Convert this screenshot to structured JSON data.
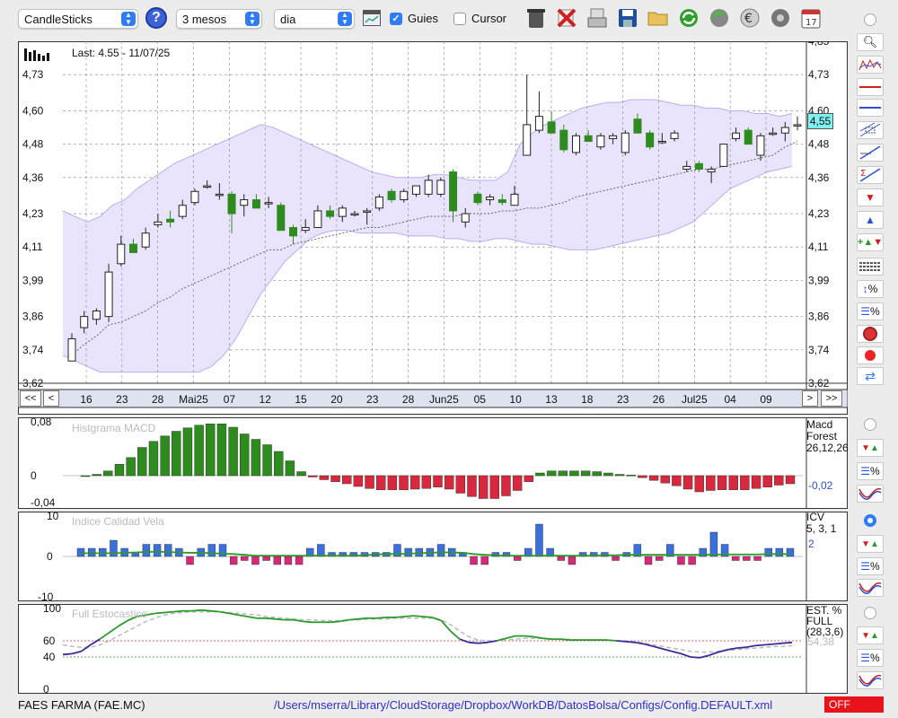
{
  "toolbar": {
    "chart_type": "CandleSticks",
    "period": "3 mesos",
    "interval": "dia",
    "guides_label": "Guies",
    "guides_checked": true,
    "cursor_label": "Cursor",
    "cursor_checked": false
  },
  "main_chart": {
    "last_label": "Last: 4.55 - 11/07/25",
    "current_price_label": "4,55",
    "y_ticks": [
      "4,73",
      "4,60",
      "4,48",
      "4,36",
      "4,23",
      "4,11",
      "3,99",
      "3,86",
      "3,74",
      "3,62"
    ],
    "y_top_partial": "4,85",
    "x_labels": [
      "16",
      "23",
      "28",
      "Mai25",
      "07",
      "12",
      "15",
      "20",
      "23",
      "28",
      "Jun25",
      "05",
      "10",
      "13",
      "18",
      "23",
      "26",
      "Jul25",
      "04",
      "09"
    ],
    "nav": {
      "first": "<<",
      "prev": "<",
      "next": ">",
      "last": ">>"
    }
  },
  "macd": {
    "title": "Histgrama MACD",
    "y_ticks": [
      "0,08",
      "0",
      "-0,04"
    ],
    "legend_name": "Macd",
    "legend_sub": "Forest",
    "legend_params": "26,12,26",
    "value": "-0,02"
  },
  "icv": {
    "title": "Indice Calidad Vela",
    "y_ticks": [
      "10",
      "0",
      "-10"
    ],
    "legend_name": "ICV",
    "legend_params": "5, 3, 1",
    "value": "2"
  },
  "stoch": {
    "title": "Full Estocastico",
    "y_ticks": [
      "100",
      "60",
      "40",
      "0"
    ],
    "legend_name": "EST. %",
    "legend_sub": "FULL",
    "legend_params": "(28,3,6)",
    "value": "54,38"
  },
  "status": {
    "ticker": "FAES FARMA (FAE.MC)",
    "path": "/Users/mserra/Library/CloudStorage/Dropbox/WorkDB/DatosBolsa/Configs/Config.DEFAULT.xml",
    "off_label": "OFF"
  },
  "colors": {
    "up": "#2e8b1e",
    "down": "#d8283e",
    "band": "#e9e4fb",
    "bandline": "#b9aef0",
    "accent": "#2f7cf6"
  },
  "chart_data": {
    "type": "candlestick",
    "ylim": [
      3.62,
      4.85
    ],
    "candles": [
      {
        "o": 3.7,
        "h": 3.8,
        "l": 3.7,
        "c": 3.78
      },
      {
        "o": 3.82,
        "h": 3.88,
        "l": 3.8,
        "c": 3.86
      },
      {
        "o": 3.85,
        "h": 3.89,
        "l": 3.83,
        "c": 3.88
      },
      {
        "o": 3.86,
        "h": 4.05,
        "l": 3.84,
        "c": 4.02
      },
      {
        "o": 4.05,
        "h": 4.15,
        "l": 4.04,
        "c": 4.12
      },
      {
        "o": 4.12,
        "h": 4.14,
        "l": 4.09,
        "c": 4.09
      },
      {
        "o": 4.11,
        "h": 4.18,
        "l": 4.1,
        "c": 4.16
      },
      {
        "o": 4.19,
        "h": 4.23,
        "l": 4.18,
        "c": 4.2
      },
      {
        "o": 4.21,
        "h": 4.24,
        "l": 4.18,
        "c": 4.2
      },
      {
        "o": 4.22,
        "h": 4.28,
        "l": 4.21,
        "c": 4.26
      },
      {
        "o": 4.27,
        "h": 4.32,
        "l": 4.26,
        "c": 4.31
      },
      {
        "o": 4.33,
        "h": 4.35,
        "l": 4.32,
        "c": 4.33
      },
      {
        "o": 4.3,
        "h": 4.34,
        "l": 4.28,
        "c": 4.3
      },
      {
        "o": 4.3,
        "h": 4.31,
        "l": 4.16,
        "c": 4.23
      },
      {
        "o": 4.26,
        "h": 4.3,
        "l": 4.22,
        "c": 4.28
      },
      {
        "o": 4.28,
        "h": 4.3,
        "l": 4.25,
        "c": 4.25
      },
      {
        "o": 4.27,
        "h": 4.29,
        "l": 4.25,
        "c": 4.27
      },
      {
        "o": 4.26,
        "h": 4.27,
        "l": 4.17,
        "c": 4.17
      },
      {
        "o": 4.18,
        "h": 4.19,
        "l": 4.12,
        "c": 4.15
      },
      {
        "o": 4.17,
        "h": 4.21,
        "l": 4.16,
        "c": 4.18
      },
      {
        "o": 4.18,
        "h": 4.26,
        "l": 4.18,
        "c": 4.24
      },
      {
        "o": 4.24,
        "h": 4.26,
        "l": 4.21,
        "c": 4.22
      },
      {
        "o": 4.22,
        "h": 4.26,
        "l": 4.2,
        "c": 4.25
      },
      {
        "o": 4.23,
        "h": 4.24,
        "l": 4.22,
        "c": 4.23
      },
      {
        "o": 4.24,
        "h": 4.25,
        "l": 4.19,
        "c": 4.24
      },
      {
        "o": 4.25,
        "h": 4.3,
        "l": 4.24,
        "c": 4.29
      },
      {
        "o": 4.31,
        "h": 4.32,
        "l": 4.27,
        "c": 4.28
      },
      {
        "o": 4.28,
        "h": 4.32,
        "l": 4.27,
        "c": 4.31
      },
      {
        "o": 4.3,
        "h": 4.33,
        "l": 4.29,
        "c": 4.33
      },
      {
        "o": 4.3,
        "h": 4.37,
        "l": 4.29,
        "c": 4.35
      },
      {
        "o": 4.3,
        "h": 4.36,
        "l": 4.29,
        "c": 4.35
      },
      {
        "o": 4.38,
        "h": 4.39,
        "l": 4.2,
        "c": 4.24
      },
      {
        "o": 4.2,
        "h": 4.25,
        "l": 4.18,
        "c": 4.23
      },
      {
        "o": 4.3,
        "h": 4.31,
        "l": 4.26,
        "c": 4.27
      },
      {
        "o": 4.28,
        "h": 4.3,
        "l": 4.26,
        "c": 4.29
      },
      {
        "o": 4.28,
        "h": 4.3,
        "l": 4.26,
        "c": 4.27
      },
      {
        "o": 4.26,
        "h": 4.33,
        "l": 4.26,
        "c": 4.3
      },
      {
        "o": 4.44,
        "h": 4.73,
        "l": 4.44,
        "c": 4.55
      },
      {
        "o": 4.53,
        "h": 4.67,
        "l": 4.52,
        "c": 4.58
      },
      {
        "o": 4.56,
        "h": 4.6,
        "l": 4.52,
        "c": 4.52
      },
      {
        "o": 4.53,
        "h": 4.55,
        "l": 4.45,
        "c": 4.46
      },
      {
        "o": 4.45,
        "h": 4.52,
        "l": 4.44,
        "c": 4.51
      },
      {
        "o": 4.51,
        "h": 4.53,
        "l": 4.49,
        "c": 4.49
      },
      {
        "o": 4.47,
        "h": 4.52,
        "l": 4.46,
        "c": 4.51
      },
      {
        "o": 4.5,
        "h": 4.52,
        "l": 4.48,
        "c": 4.51
      },
      {
        "o": 4.45,
        "h": 4.53,
        "l": 4.44,
        "c": 4.52
      },
      {
        "o": 4.57,
        "h": 4.59,
        "l": 4.52,
        "c": 4.52
      },
      {
        "o": 4.52,
        "h": 4.53,
        "l": 4.46,
        "c": 4.47
      },
      {
        "o": 4.49,
        "h": 4.52,
        "l": 4.48,
        "c": 4.49
      },
      {
        "o": 4.5,
        "h": 4.53,
        "l": 4.49,
        "c": 4.52
      },
      {
        "o": 4.39,
        "h": 4.42,
        "l": 4.38,
        "c": 4.4
      },
      {
        "o": 4.41,
        "h": 4.42,
        "l": 4.38,
        "c": 4.39
      },
      {
        "o": 4.38,
        "h": 4.4,
        "l": 4.34,
        "c": 4.39
      },
      {
        "o": 4.4,
        "h": 4.48,
        "l": 4.4,
        "c": 4.48
      },
      {
        "o": 4.5,
        "h": 4.54,
        "l": 4.49,
        "c": 4.52
      },
      {
        "o": 4.53,
        "h": 4.54,
        "l": 4.48,
        "c": 4.48
      },
      {
        "o": 4.44,
        "h": 4.52,
        "l": 4.42,
        "c": 4.51
      },
      {
        "o": 4.52,
        "h": 4.54,
        "l": 4.51,
        "c": 4.52
      },
      {
        "o": 4.52,
        "h": 4.56,
        "l": 4.49,
        "c": 4.54
      },
      {
        "o": 4.55,
        "h": 4.58,
        "l": 4.53,
        "c": 4.55
      }
    ],
    "sma": [
      3.72,
      3.76,
      3.79,
      3.83,
      3.84,
      3.86,
      3.88,
      3.91,
      3.93,
      3.96,
      3.98,
      4.0,
      4.02,
      4.04,
      4.06,
      4.08,
      4.1,
      4.1,
      4.12,
      4.13,
      4.14,
      4.15,
      4.16,
      4.17,
      4.18,
      4.18,
      4.19,
      4.2,
      4.21,
      4.22,
      4.22,
      4.22,
      4.23,
      4.23,
      4.23,
      4.24,
      4.24,
      4.25,
      4.25,
      4.26,
      4.27,
      4.29,
      4.3,
      4.31,
      4.32,
      4.33,
      4.34,
      4.35,
      4.36,
      4.37,
      4.38,
      4.39,
      4.39,
      4.4,
      4.41,
      4.42,
      4.43,
      4.44,
      4.47,
      4.49
    ],
    "band_upper": [
      4.24,
      4.22,
      4.2,
      4.22,
      4.26,
      4.28,
      4.32,
      4.35,
      4.38,
      4.41,
      4.43,
      4.45,
      4.47,
      4.49,
      4.51,
      4.53,
      4.55,
      4.54,
      4.52,
      4.5,
      4.48,
      4.46,
      4.44,
      4.42,
      4.4,
      4.38,
      4.37,
      4.36,
      4.36,
      4.36,
      4.37,
      4.37,
      4.36,
      4.35,
      4.35,
      4.35,
      4.38,
      4.48,
      4.52,
      4.55,
      4.57,
      4.59,
      4.61,
      4.62,
      4.63,
      4.63,
      4.64,
      4.64,
      4.64,
      4.63,
      4.62,
      4.62,
      4.61,
      4.61,
      4.6,
      4.6,
      4.59,
      4.59,
      4.58,
      4.59
    ],
    "band_lower": [
      3.72,
      3.7,
      3.68,
      3.66,
      3.66,
      3.66,
      3.66,
      3.66,
      3.66,
      3.66,
      3.66,
      3.66,
      3.68,
      3.72,
      3.78,
      3.86,
      3.94,
      4.0,
      4.06,
      4.1,
      4.14,
      4.16,
      4.17,
      4.17,
      4.16,
      4.16,
      4.16,
      4.16,
      4.15,
      4.15,
      4.15,
      4.14,
      4.14,
      4.13,
      4.13,
      4.14,
      4.14,
      4.13,
      4.12,
      4.12,
      4.11,
      4.1,
      4.1,
      4.1,
      4.11,
      4.12,
      4.13,
      4.14,
      4.15,
      4.16,
      4.18,
      4.2,
      4.24,
      4.28,
      4.32,
      4.34,
      4.36,
      4.38,
      4.39,
      4.4
    ],
    "macd_hist": [
      0.0,
      0.002,
      0.007,
      0.017,
      0.027,
      0.042,
      0.051,
      0.059,
      0.066,
      0.071,
      0.075,
      0.077,
      0.077,
      0.072,
      0.062,
      0.054,
      0.046,
      0.036,
      0.022,
      0.006,
      -0.002,
      -0.006,
      -0.009,
      -0.012,
      -0.016,
      -0.019,
      -0.021,
      -0.021,
      -0.021,
      -0.02,
      -0.019,
      -0.017,
      -0.02,
      -0.026,
      -0.031,
      -0.034,
      -0.034,
      -0.03,
      -0.022,
      -0.009,
      0.004,
      0.007,
      0.007,
      0.007,
      0.007,
      0.006,
      0.004,
      0.002,
      0.001,
      -0.003,
      -0.007,
      -0.011,
      -0.015,
      -0.02,
      -0.024,
      -0.022,
      -0.021,
      -0.021,
      -0.021,
      -0.019,
      -0.017,
      -0.014,
      -0.012
    ],
    "icv": [
      2,
      2,
      2,
      4,
      2,
      1,
      3,
      3,
      3,
      2,
      -2,
      2,
      3,
      3,
      -2,
      -1,
      -2,
      -1,
      -2,
      -2,
      -2,
      2,
      3,
      1,
      1,
      1,
      1,
      1,
      1,
      3,
      2,
      2,
      2,
      3,
      2,
      1,
      -2,
      -2,
      1,
      1,
      -1,
      2,
      8,
      2,
      -1,
      -2,
      1,
      1,
      1,
      -1,
      1,
      3,
      -2,
      -1,
      3,
      -2,
      -2,
      2,
      6,
      3,
      -1,
      -1,
      -1,
      2,
      2,
      2
    ],
    "icv_ma": [
      0.8,
      0.8,
      0.8,
      0.8,
      0.9,
      1.0,
      1.1,
      1.2,
      1.1,
      1.0,
      0.9,
      0.9,
      0.8,
      0.7,
      0.6,
      0.4,
      0.2,
      0.2,
      0.2,
      0.2,
      0.2,
      0.2,
      0.2,
      0.2,
      0.2,
      0.2,
      0.3,
      0.5,
      0.6,
      0.6,
      0.7,
      0.8,
      0.9,
      1.0,
      1.0,
      0.9,
      0.6,
      0.4,
      0.3,
      0.2,
      0.2,
      0.2,
      0.2,
      0.2,
      0.2,
      0.2,
      0.2,
      0.2,
      0.3,
      0.3,
      0.4,
      0.4,
      0.4,
      0.4,
      0.4,
      0.4,
      0.4,
      0.4,
      0.5,
      0.5,
      0.5,
      0.5,
      0.5,
      0.6,
      0.6,
      0.6
    ],
    "stoch_k": [
      43,
      44,
      47,
      55,
      62,
      70,
      78,
      85,
      90,
      92,
      94,
      95,
      96,
      97,
      97,
      98,
      97,
      96,
      94,
      92,
      90,
      88,
      88,
      87,
      86,
      86,
      84,
      83,
      83,
      83,
      84,
      86,
      87,
      88,
      88,
      89,
      89,
      90,
      91,
      90,
      89,
      85,
      72,
      62,
      58,
      57,
      58,
      60,
      63,
      66,
      66,
      65,
      63,
      62,
      62,
      61,
      61,
      61,
      61,
      61,
      60,
      59,
      58,
      56,
      53,
      50,
      47,
      44,
      40,
      39,
      42,
      46,
      49,
      51,
      52,
      54,
      55,
      56,
      57,
      58
    ],
    "stoch_d": [
      55,
      53,
      52,
      52,
      55,
      60,
      66,
      72,
      78,
      84,
      88,
      92,
      94,
      95,
      96,
      96,
      96,
      96,
      95,
      94,
      93,
      92,
      90,
      89,
      88,
      87,
      86,
      86,
      85,
      85,
      85,
      86,
      86,
      87,
      87,
      87,
      88,
      88,
      88,
      88,
      88,
      86,
      80,
      72,
      65,
      61,
      60,
      60,
      61,
      62,
      63,
      63,
      63,
      62,
      62,
      62,
      61,
      61,
      61,
      61,
      60,
      60,
      59,
      57,
      55,
      53,
      51,
      49,
      47,
      46,
      46,
      47,
      48,
      49,
      50,
      51,
      52,
      53,
      53,
      54
    ]
  }
}
